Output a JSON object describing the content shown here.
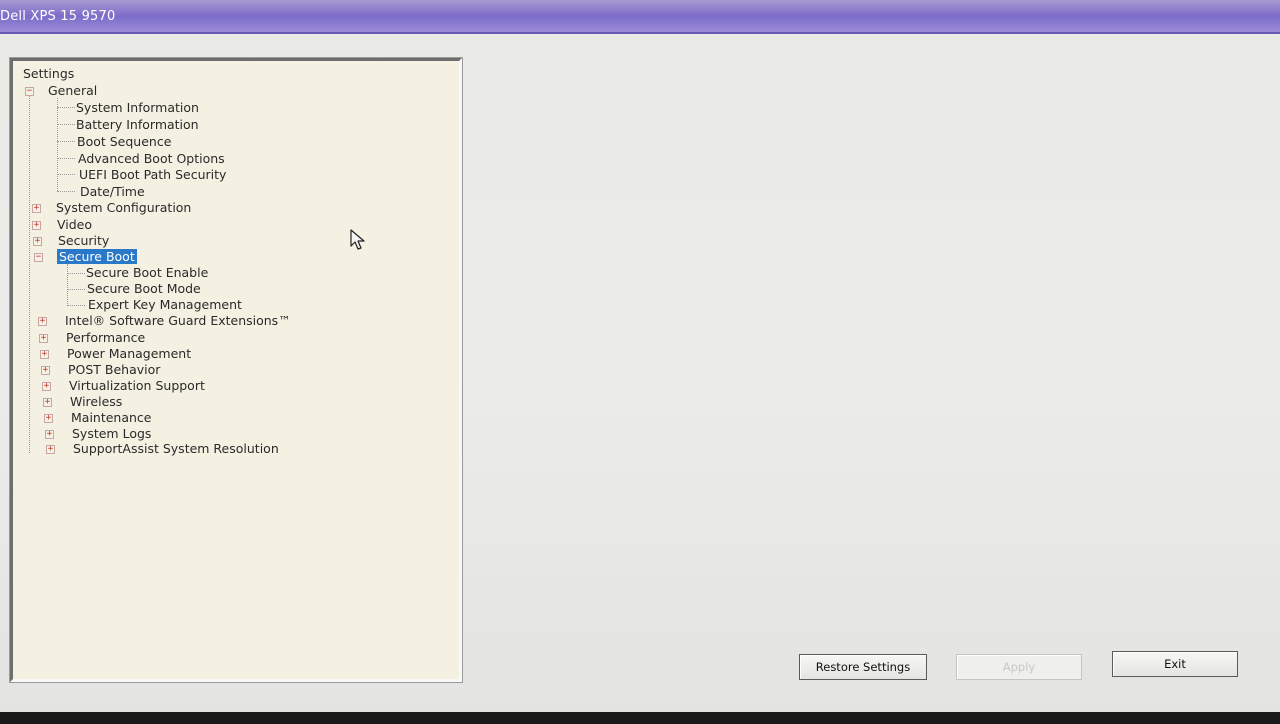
{
  "window": {
    "title": "Dell XPS 15 9570"
  },
  "tree": {
    "root_label": "Settings",
    "nodes": {
      "general": "General",
      "system_information": "System Information",
      "battery_information": "Battery Information",
      "boot_sequence": "Boot Sequence",
      "advanced_boot_options": "Advanced Boot Options",
      "uefi_boot_path_security": "UEFI Boot Path Security",
      "date_time": "Date/Time",
      "system_configuration": "System Configuration",
      "video": "Video",
      "security": "Security",
      "secure_boot": "Secure Boot",
      "secure_boot_enable": "Secure Boot Enable",
      "secure_boot_mode": "Secure Boot Mode",
      "expert_key_management": "Expert Key Management",
      "intel_sgx": "Intel® Software Guard Extensions™",
      "performance": "Performance",
      "power_management": "Power Management",
      "post_behavior": "POST Behavior",
      "virtualization_support": "Virtualization Support",
      "wireless": "Wireless",
      "maintenance": "Maintenance",
      "system_logs": "System Logs",
      "supportassist": "SupportAssist System Resolution"
    },
    "selected": "Secure Boot",
    "expander_collapsed": "+",
    "expander_expanded": "−"
  },
  "buttons": {
    "restore_settings": "Restore Settings",
    "apply": "Apply",
    "exit": "Exit"
  },
  "colors": {
    "titlebar": "#7c6cc8",
    "selection": "#2a78c8",
    "tree_background": "#f4f1e3"
  }
}
